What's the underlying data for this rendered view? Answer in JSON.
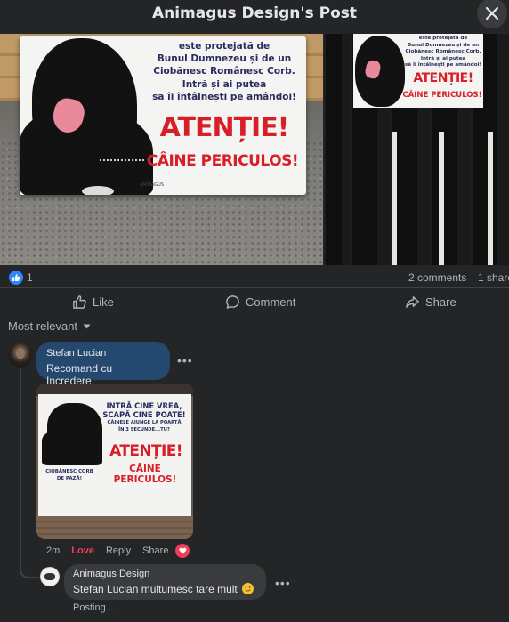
{
  "header": {
    "title": "Animagus Design's Post",
    "close_icon": "close-icon"
  },
  "photos": {
    "left_sign": {
      "lines": [
        "este protejată de",
        "Bunul Dumnezeu și de un",
        "Ciobănesc Românesc Corb.",
        "Intră și ai putea",
        "să îi întâlnești pe amândoi!"
      ],
      "warning": "ATENȚIE!",
      "danger": "CÂINE PERICULOS!",
      "brand": "ANIMAGUS"
    },
    "right_sign": {
      "lines": [
        "este protejată de",
        "Bunul Dumnezeu și de un",
        "Ciobănesc Românesc Corb.",
        "Intră și ai putea",
        "să îi întâlnești pe amândoi!"
      ],
      "warning": "ATENȚIE!",
      "danger": "CÂINE PERICULOS!"
    }
  },
  "reactions": {
    "icon": "like-icon",
    "count": "1",
    "comments": "2 comments",
    "shares": "1 share"
  },
  "actions": {
    "like": "Like",
    "comment": "Comment",
    "share": "Share"
  },
  "sort": {
    "label": "Most relevant"
  },
  "comments": [
    {
      "author": "Stefan Lucian",
      "text": "Recomand cu Incredere",
      "image": {
        "lines": [
          "INTRĂ CINE VREA,",
          "SCAPĂ CINE POATE!",
          "CÂINELE AJUNGE LA POARTĂ",
          "ÎN 3 SECUNDE...TU?"
        ],
        "warning": "ATENȚIE!",
        "danger": "CÂINE PERICULOS!",
        "caption": [
          "CIOBĂNESC CORB",
          "DE PAZĂ!"
        ]
      },
      "meta": {
        "time": "2m",
        "love": "Love",
        "reply": "Reply",
        "share": "Share"
      },
      "reaction_icon": "heart-icon"
    },
    {
      "author": "Animagus Design",
      "text": "Stefan Lucian multumesc tare mult",
      "emoji": "smile-emoji-icon",
      "status": "Posting..."
    }
  ],
  "colors": {
    "background": "#242526",
    "bubble": "#3a3b3c",
    "highlight_bubble": "#25496e",
    "love": "#f33e58",
    "like": "#2d88ff",
    "sign_red": "#d91e28"
  }
}
